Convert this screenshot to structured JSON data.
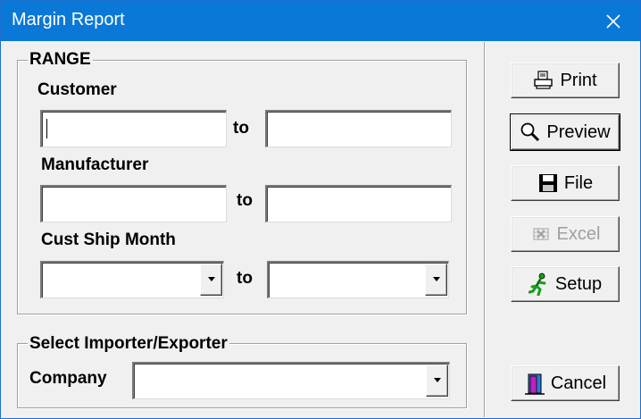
{
  "window": {
    "title": "Margin Report",
    "close_glyph": "✕"
  },
  "range": {
    "legend": "RANGE",
    "customer_label": "Customer",
    "customer_from": "",
    "customer_to": "",
    "manufacturer_label": "Manufacturer",
    "manufacturer_from": "",
    "manufacturer_to": "",
    "ship_month_label": "Cust Ship Month",
    "ship_month_from": "",
    "ship_month_to": "",
    "to_label": "to"
  },
  "importer": {
    "legend": "Select Importer/Exporter",
    "company_label": "Company",
    "company_value": ""
  },
  "buttons": {
    "print": "Print",
    "preview": "Preview",
    "file": "File",
    "excel": "Excel",
    "setup": "Setup",
    "cancel": "Cancel"
  },
  "icons": {
    "print": "printer-icon",
    "preview": "magnifier-icon",
    "file": "floppy-disk-icon",
    "excel": "excel-icon",
    "setup": "running-man-icon",
    "cancel": "exit-door-icon"
  },
  "colors": {
    "titlebar": "#0a78d7",
    "dialog": "#f0f0f0",
    "disabled_text": "#a0a0a0"
  }
}
